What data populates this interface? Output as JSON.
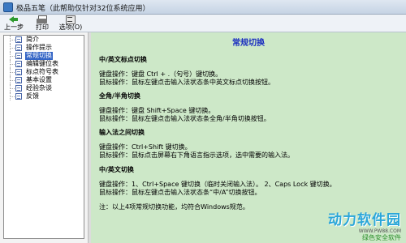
{
  "window": {
    "title": "极品五笔（此帮助仅针对32位系统应用）"
  },
  "toolbar": {
    "back_label": "上一步",
    "print_label": "打印",
    "options_label": "选项(O)"
  },
  "sidebar": {
    "items": [
      {
        "label": "简介"
      },
      {
        "label": "操作提示"
      },
      {
        "label": "常规切换",
        "selected": true
      },
      {
        "label": "编辑键位表"
      },
      {
        "label": "标点符号表"
      },
      {
        "label": "基本设置"
      },
      {
        "label": "经验杂谈"
      },
      {
        "label": "反馈"
      }
    ]
  },
  "content": {
    "title": "常规切换",
    "sections": [
      {
        "heading": "中/英文标点切换",
        "lines": [
          "键盘操作：键盘 Ctrl + .（句号）键切换。",
          "鼠标操作：鼠标左键点击输入法状态条中英文标点切换按钮。"
        ]
      },
      {
        "heading": "全角/半角切换",
        "lines": [
          "键盘操作：键盘 Shift+Space 键切换。",
          "鼠标操作：鼠标左键点击输入法状态条全角/半角切换按钮。"
        ]
      },
      {
        "heading": "输入法之间切换",
        "lines": [
          "键盘操作：Ctrl+Shift 键切换。",
          "鼠标操作：鼠标点击屏幕右下角语言指示选项，选中需要的输入法。"
        ]
      },
      {
        "heading": "中/英文切换",
        "lines": [
          "键盘操作：1、Ctrl+Space 键切换（临时关闭输入法）。 2、Caps Lock 键切换。",
          "鼠标操作：鼠标左键点击输入法状态条“中/A”切换按钮。"
        ]
      }
    ],
    "note": "注：以上4项常规切换功能，均符合Windows规范。"
  },
  "watermark": {
    "brand": "动力软件园",
    "url": "WWW.PW88.COM",
    "tagline": "绿色安全软件"
  }
}
